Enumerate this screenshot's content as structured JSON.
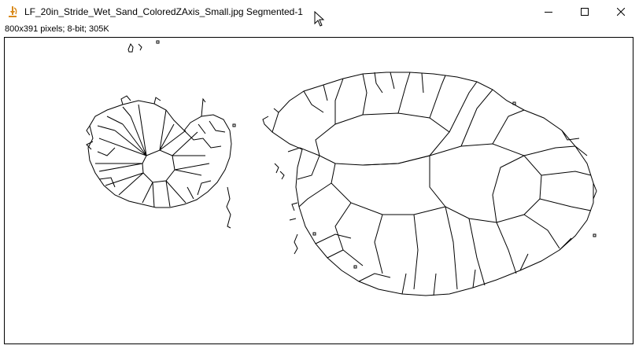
{
  "window": {
    "title": "LF_20in_Stride_Wet_Sand_ColoredZAxis_Small.jpg Segmented-1",
    "app_icon": "imagej-microscope-icon",
    "controls": [
      "minimize-icon",
      "maximize-icon",
      "close-icon"
    ]
  },
  "image_info": "800x391 pixels; 8-bit; 305K",
  "canvas": {
    "content": "segmented-watershed-image",
    "background_color": "#ffffff",
    "line_color": "#000000"
  },
  "colors": {
    "icon_accent": "#d98a1c"
  }
}
